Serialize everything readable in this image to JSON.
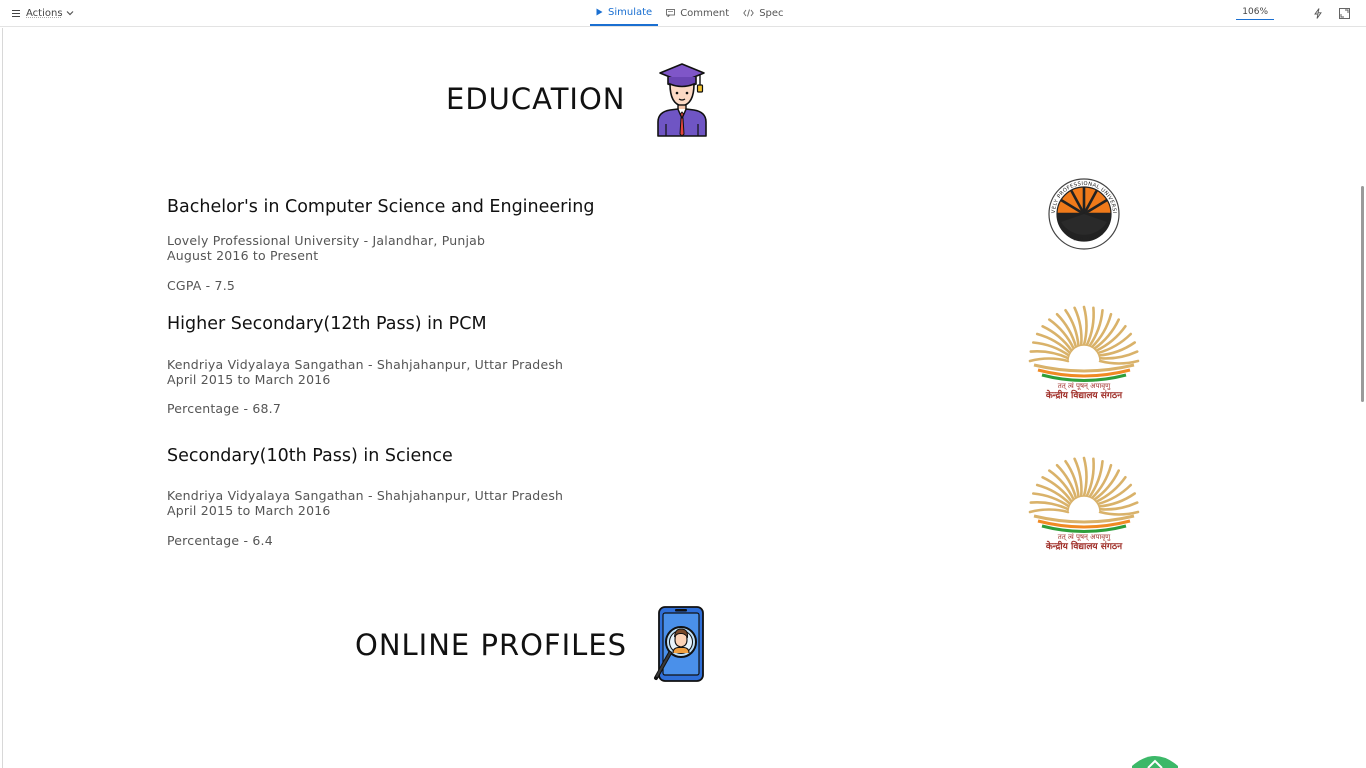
{
  "toolbar": {
    "actions_label": "Actions",
    "tabs": [
      {
        "label": "Simulate",
        "active": true
      },
      {
        "label": "Comment",
        "active": false
      },
      {
        "label": "Spec",
        "active": false
      }
    ],
    "zoom": "106%"
  },
  "education": {
    "title": "EDUCATION",
    "entries": [
      {
        "degree": "Bachelor's in Computer Science and Engineering",
        "institution": "Lovely Professional University - Jalandhar, Punjab",
        "period": "August 2016 to Present",
        "score": "CGPA - 7.5",
        "logo_text_top": "LOVELY PROFESSIONAL UNIVERSITY",
        "logo_text_bottom": "PUNJAB (INDIA)"
      },
      {
        "degree": "Higher Secondary(12th Pass) in PCM",
        "institution": "Kendriya Vidyalaya Sangathan - Shahjahanpur, Uttar Pradesh",
        "period": "April 2015 to March 2016",
        "score": "Percentage - 68.7",
        "logo_text_motto": "तत् त्वं पूषन् अपावृणु",
        "logo_text_name": "केन्द्रीय विद्यालय संगठन"
      },
      {
        "degree": "Secondary(10th Pass) in Science",
        "institution": "Kendriya Vidyalaya Sangathan - Shahjahanpur, Uttar Pradesh",
        "period": "April 2015 to March 2016",
        "score": "Percentage - 6.4",
        "logo_text_motto": "तत् त्वं पूषन् अपावृणु",
        "logo_text_name": "केन्द्रीय विद्यालय संगठन"
      }
    ]
  },
  "online_profiles": {
    "title": "ONLINE PROFILES"
  },
  "colors": {
    "accent": "#1a6fd1",
    "lpu_orange": "#f07a1a",
    "kvs_gold": "#d9b26a",
    "kvs_saffron": "#f08a24",
    "kvs_green": "#2e9e3a",
    "kvs_text": "#a0302a"
  }
}
